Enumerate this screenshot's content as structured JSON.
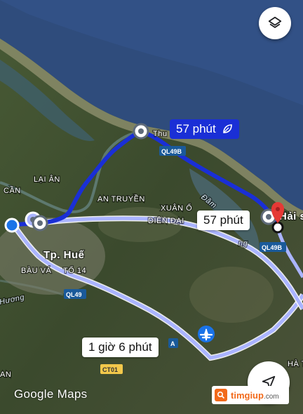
{
  "map": {
    "places": {
      "thuan_an": "Thu",
      "lai_an": "LẠI ÂN",
      "can": "CẦN",
      "an_truyen": "AN TRUYỀN",
      "xuan_o": "XUÂN Ổ",
      "dien_dai": "DIÊN ĐẠI",
      "dam_lagoon": "Đầm",
      "dam_suffix": "ng",
      "hai_son": "Hải s",
      "tp_hue": "Tp. Huế",
      "bau_va": "BÀU VÁ",
      "to_14": "TỔ 14",
      "huong": "Hương",
      "an": "AN",
      "ha_t": "HÀ T"
    },
    "shields": {
      "ql49b_top": "QL49B",
      "ql49b_right": "QL49B",
      "ql49": "QL49",
      "ct01": "CT01",
      "a_partial": "A"
    }
  },
  "routes": {
    "primary_eta": "57 phút",
    "alternative_1_eta": "57 phút",
    "alternative_2_eta": "1 giờ 6 phút",
    "primary_color": "#1a2fd6",
    "alternative_color": "#aab4ff"
  },
  "controls": {
    "layers_icon": "layers-icon",
    "navigate_icon": "navigation-arrow-icon"
  },
  "branding": {
    "google_maps": "Google Maps",
    "watermark_site": "timgiup",
    "watermark_tld": ".com"
  },
  "colors": {
    "sea": "#2f4c7c",
    "land": "#3a4a2c",
    "primary_route": "#1a2fd6",
    "alt_route": "#aab4ff",
    "destination_pin": "#e53935",
    "watermark_orange": "#f26a1b"
  }
}
